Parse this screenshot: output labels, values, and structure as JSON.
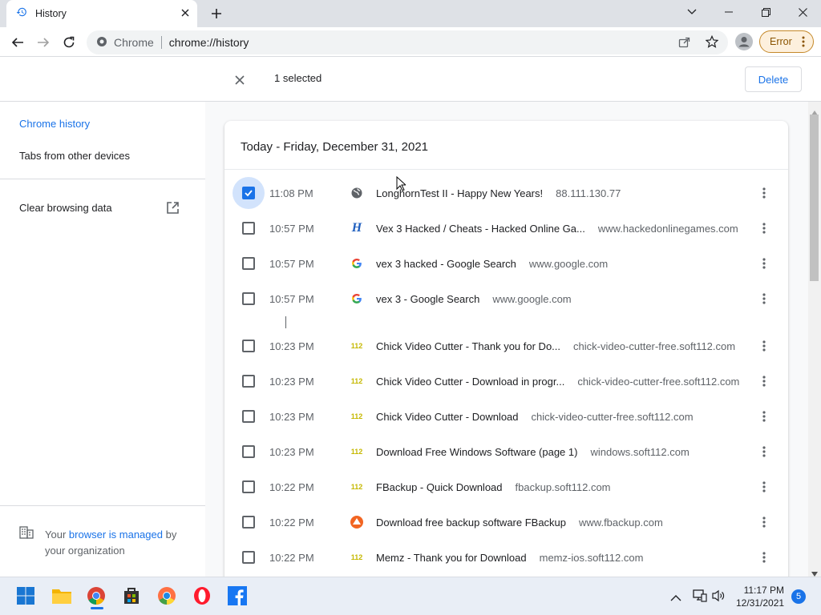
{
  "tab": {
    "title": "History"
  },
  "toolbar": {
    "site": "Chrome",
    "url": "chrome://history",
    "error_label": "Error"
  },
  "header": {
    "selected": "1 selected",
    "delete_label": "Delete"
  },
  "sidebar": {
    "chrome_history": "Chrome history",
    "tabs_other": "Tabs from other devices",
    "clear_data": "Clear browsing data",
    "managed_prefix": "Your",
    "managed_link": "browser is managed",
    "managed_suffix": "by",
    "managed_line2": "your organization"
  },
  "history": {
    "date_title": "Today - Friday, December 31, 2021",
    "rows": [
      {
        "time": "11:08 PM",
        "title": "LonghornTest II - Happy New Years!",
        "domain": "88.111.130.77",
        "icon": "globe-icon",
        "checked": true
      },
      {
        "time": "10:57 PM",
        "title": "Vex 3 Hacked / Cheats - Hacked Online Ga...",
        "domain": "www.hackedonlinegames.com",
        "icon": "hackedonlinegames-icon",
        "checked": false
      },
      {
        "time": "10:57 PM",
        "title": "vex 3 hacked - Google Search",
        "domain": "www.google.com",
        "icon": "google-icon",
        "checked": false
      },
      {
        "time": "10:57 PM",
        "title": "vex 3 - Google Search",
        "domain": "www.google.com",
        "icon": "google-icon",
        "checked": false
      },
      {
        "time": "10:23 PM",
        "title": "Chick Video Cutter - Thank you for Do...",
        "domain": "chick-video-cutter-free.soft112.com",
        "icon": "soft112-icon",
        "checked": false
      },
      {
        "time": "10:23 PM",
        "title": "Chick Video Cutter - Download in progr...",
        "domain": "chick-video-cutter-free.soft112.com",
        "icon": "soft112-icon",
        "checked": false
      },
      {
        "time": "10:23 PM",
        "title": "Chick Video Cutter - Download",
        "domain": "chick-video-cutter-free.soft112.com",
        "icon": "soft112-icon",
        "checked": false
      },
      {
        "time": "10:23 PM",
        "title": "Download Free Windows Software (page 1)",
        "domain": "windows.soft112.com",
        "icon": "soft112-icon",
        "checked": false
      },
      {
        "time": "10:22 PM",
        "title": "FBackup - Quick Download",
        "domain": "fbackup.soft112.com",
        "icon": "soft112-icon",
        "checked": false
      },
      {
        "time": "10:22 PM",
        "title": "Download free backup software FBackup",
        "domain": "www.fbackup.com",
        "icon": "fbackup-icon",
        "checked": false
      },
      {
        "time": "10:22 PM",
        "title": "Memz - Thank you for Download",
        "domain": "memz-ios.soft112.com",
        "icon": "soft112-icon",
        "checked": false
      }
    ]
  },
  "taskbar": {
    "time": "11:17 PM",
    "date": "12/31/2021",
    "notifications": "5",
    "soft112_text": "112",
    "hacked_text": "H"
  },
  "colors": {
    "accent": "#1a73e8",
    "error_bg": "#fdf0dd"
  }
}
